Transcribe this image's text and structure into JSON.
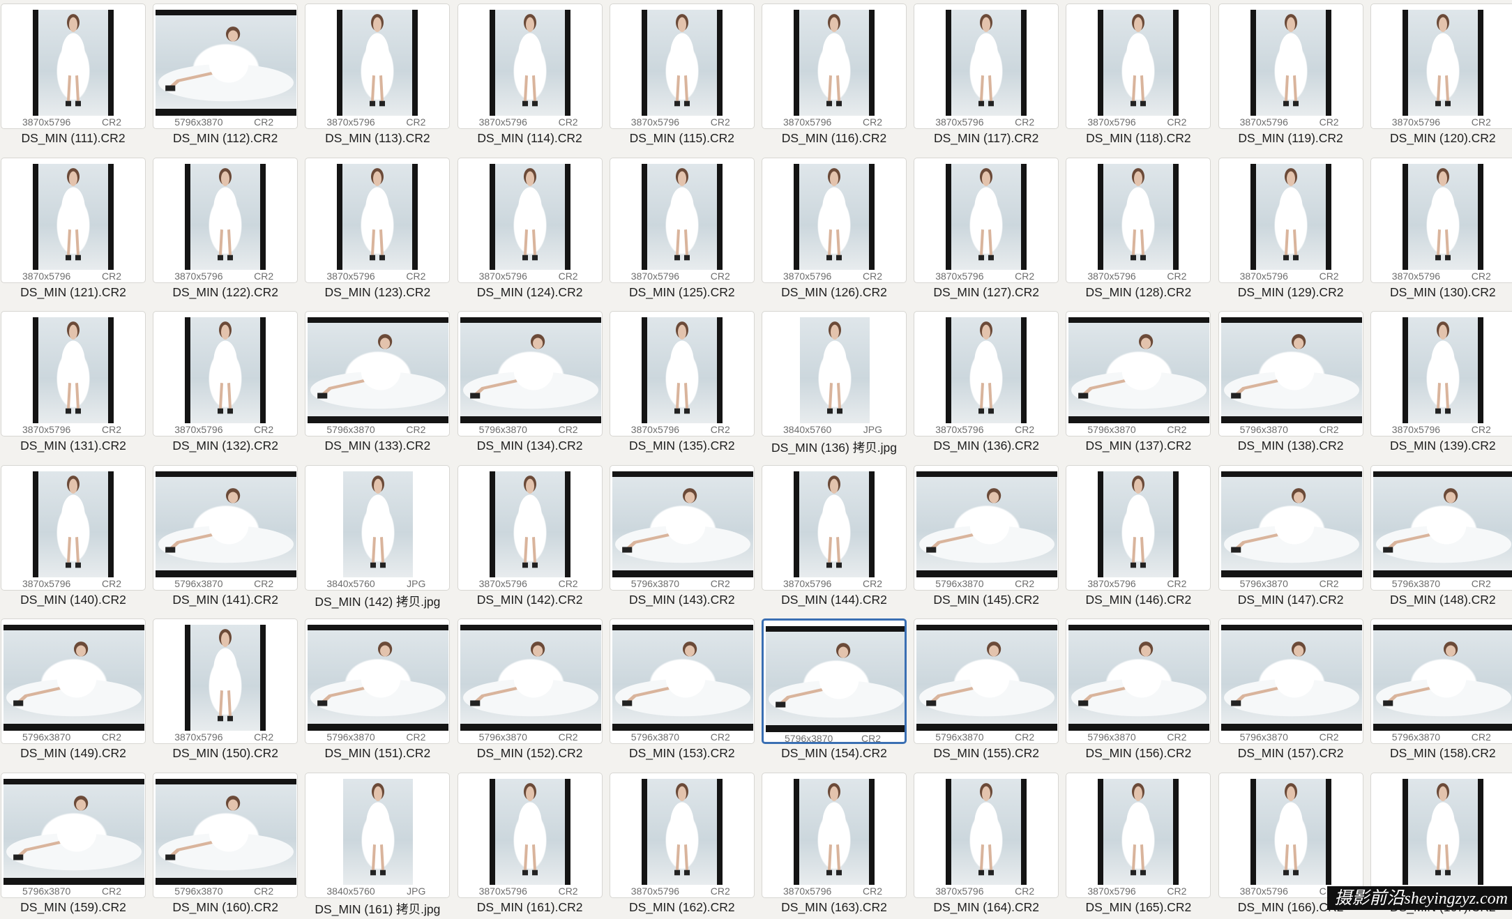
{
  "files": [
    {
      "name": "DS_MIN (111).CR2",
      "dims": "3870x5796",
      "type": "CR2",
      "orient": "portrait"
    },
    {
      "name": "DS_MIN (112).CR2",
      "dims": "5796x3870",
      "type": "CR2",
      "orient": "landscape"
    },
    {
      "name": "DS_MIN (113).CR2",
      "dims": "3870x5796",
      "type": "CR2",
      "orient": "portrait"
    },
    {
      "name": "DS_MIN (114).CR2",
      "dims": "3870x5796",
      "type": "CR2",
      "orient": "portrait"
    },
    {
      "name": "DS_MIN (115).CR2",
      "dims": "3870x5796",
      "type": "CR2",
      "orient": "portrait"
    },
    {
      "name": "DS_MIN (116).CR2",
      "dims": "3870x5796",
      "type": "CR2",
      "orient": "portrait"
    },
    {
      "name": "DS_MIN (117).CR2",
      "dims": "3870x5796",
      "type": "CR2",
      "orient": "portrait"
    },
    {
      "name": "DS_MIN (118).CR2",
      "dims": "3870x5796",
      "type": "CR2",
      "orient": "portrait"
    },
    {
      "name": "DS_MIN (119).CR2",
      "dims": "3870x5796",
      "type": "CR2",
      "orient": "portrait"
    },
    {
      "name": "DS_MIN (120).CR2",
      "dims": "3870x5796",
      "type": "CR2",
      "orient": "portrait"
    },
    {
      "name": "DS_MIN (121).CR2",
      "dims": "3870x5796",
      "type": "CR2",
      "orient": "portrait"
    },
    {
      "name": "DS_MIN (122).CR2",
      "dims": "3870x5796",
      "type": "CR2",
      "orient": "portrait"
    },
    {
      "name": "DS_MIN (123).CR2",
      "dims": "3870x5796",
      "type": "CR2",
      "orient": "portrait"
    },
    {
      "name": "DS_MIN (124).CR2",
      "dims": "3870x5796",
      "type": "CR2",
      "orient": "portrait"
    },
    {
      "name": "DS_MIN (125).CR2",
      "dims": "3870x5796",
      "type": "CR2",
      "orient": "portrait"
    },
    {
      "name": "DS_MIN (126).CR2",
      "dims": "3870x5796",
      "type": "CR2",
      "orient": "portrait"
    },
    {
      "name": "DS_MIN (127).CR2",
      "dims": "3870x5796",
      "type": "CR2",
      "orient": "portrait"
    },
    {
      "name": "DS_MIN (128).CR2",
      "dims": "3870x5796",
      "type": "CR2",
      "orient": "portrait"
    },
    {
      "name": "DS_MIN (129).CR2",
      "dims": "3870x5796",
      "type": "CR2",
      "orient": "portrait"
    },
    {
      "name": "DS_MIN (130).CR2",
      "dims": "3870x5796",
      "type": "CR2",
      "orient": "portrait"
    },
    {
      "name": "DS_MIN (131).CR2",
      "dims": "3870x5796",
      "type": "CR2",
      "orient": "portrait"
    },
    {
      "name": "DS_MIN (132).CR2",
      "dims": "3870x5796",
      "type": "CR2",
      "orient": "portrait"
    },
    {
      "name": "DS_MIN (133).CR2",
      "dims": "5796x3870",
      "type": "CR2",
      "orient": "landscape"
    },
    {
      "name": "DS_MIN (134).CR2",
      "dims": "5796x3870",
      "type": "CR2",
      "orient": "landscape"
    },
    {
      "name": "DS_MIN (135).CR2",
      "dims": "3870x5796",
      "type": "CR2",
      "orient": "portrait"
    },
    {
      "name": "DS_MIN (136) 拷贝.jpg",
      "dims": "3840x5760",
      "type": "JPG",
      "orient": "jpg"
    },
    {
      "name": "DS_MIN (136).CR2",
      "dims": "3870x5796",
      "type": "CR2",
      "orient": "portrait"
    },
    {
      "name": "DS_MIN (137).CR2",
      "dims": "5796x3870",
      "type": "CR2",
      "orient": "landscape"
    },
    {
      "name": "DS_MIN (138).CR2",
      "dims": "5796x3870",
      "type": "CR2",
      "orient": "landscape"
    },
    {
      "name": "DS_MIN (139).CR2",
      "dims": "3870x5796",
      "type": "CR2",
      "orient": "portrait"
    },
    {
      "name": "DS_MIN (140).CR2",
      "dims": "3870x5796",
      "type": "CR2",
      "orient": "portrait"
    },
    {
      "name": "DS_MIN (141).CR2",
      "dims": "5796x3870",
      "type": "CR2",
      "orient": "landscape"
    },
    {
      "name": "DS_MIN (142) 拷贝.jpg",
      "dims": "3840x5760",
      "type": "JPG",
      "orient": "jpg"
    },
    {
      "name": "DS_MIN (142).CR2",
      "dims": "3870x5796",
      "type": "CR2",
      "orient": "portrait"
    },
    {
      "name": "DS_MIN (143).CR2",
      "dims": "5796x3870",
      "type": "CR2",
      "orient": "landscape"
    },
    {
      "name": "DS_MIN (144).CR2",
      "dims": "3870x5796",
      "type": "CR2",
      "orient": "portrait"
    },
    {
      "name": "DS_MIN (145).CR2",
      "dims": "5796x3870",
      "type": "CR2",
      "orient": "landscape"
    },
    {
      "name": "DS_MIN (146).CR2",
      "dims": "3870x5796",
      "type": "CR2",
      "orient": "portrait"
    },
    {
      "name": "DS_MIN (147).CR2",
      "dims": "5796x3870",
      "type": "CR2",
      "orient": "landscape"
    },
    {
      "name": "DS_MIN (148).CR2",
      "dims": "5796x3870",
      "type": "CR2",
      "orient": "landscape"
    },
    {
      "name": "DS_MIN (149).CR2",
      "dims": "5796x3870",
      "type": "CR2",
      "orient": "landscape"
    },
    {
      "name": "DS_MIN (150).CR2",
      "dims": "3870x5796",
      "type": "CR2",
      "orient": "portrait"
    },
    {
      "name": "DS_MIN (151).CR2",
      "dims": "5796x3870",
      "type": "CR2",
      "orient": "landscape"
    },
    {
      "name": "DS_MIN (152).CR2",
      "dims": "5796x3870",
      "type": "CR2",
      "orient": "landscape"
    },
    {
      "name": "DS_MIN (153).CR2",
      "dims": "5796x3870",
      "type": "CR2",
      "orient": "landscape"
    },
    {
      "name": "DS_MIN (154).CR2",
      "dims": "5796x3870",
      "type": "CR2",
      "orient": "landscape",
      "selected": true
    },
    {
      "name": "DS_MIN (155).CR2",
      "dims": "5796x3870",
      "type": "CR2",
      "orient": "landscape"
    },
    {
      "name": "DS_MIN (156).CR2",
      "dims": "5796x3870",
      "type": "CR2",
      "orient": "landscape"
    },
    {
      "name": "DS_MIN (157).CR2",
      "dims": "5796x3870",
      "type": "CR2",
      "orient": "landscape"
    },
    {
      "name": "DS_MIN (158).CR2",
      "dims": "5796x3870",
      "type": "CR2",
      "orient": "landscape"
    },
    {
      "name": "DS_MIN (159).CR2",
      "dims": "5796x3870",
      "type": "CR2",
      "orient": "landscape"
    },
    {
      "name": "DS_MIN (160).CR2",
      "dims": "5796x3870",
      "type": "CR2",
      "orient": "landscape"
    },
    {
      "name": "DS_MIN (161) 拷贝.jpg",
      "dims": "3840x5760",
      "type": "JPG",
      "orient": "jpg"
    },
    {
      "name": "DS_MIN (161).CR2",
      "dims": "3870x5796",
      "type": "CR2",
      "orient": "portrait"
    },
    {
      "name": "DS_MIN (162).CR2",
      "dims": "3870x5796",
      "type": "CR2",
      "orient": "portrait"
    },
    {
      "name": "DS_MIN (163).CR2",
      "dims": "3870x5796",
      "type": "CR2",
      "orient": "portrait"
    },
    {
      "name": "DS_MIN (164).CR2",
      "dims": "3870x5796",
      "type": "CR2",
      "orient": "portrait"
    },
    {
      "name": "DS_MIN (165).CR2",
      "dims": "3870x5796",
      "type": "CR2",
      "orient": "portrait"
    },
    {
      "name": "DS_MIN (166).CR2",
      "dims": "3870x5796",
      "type": "CR2",
      "orient": "portrait"
    },
    {
      "name": "DS_MIN (167).CR2",
      "dims": "3870x5796",
      "type": "CR2",
      "orient": "portrait"
    }
  ],
  "watermark": {
    "prefix": "摄影前沿",
    "url": "sheyingzyz.com"
  },
  "colors": {
    "selection": "#3a6fb3",
    "background": "#f3f2ef",
    "letterbox": "#141414"
  }
}
